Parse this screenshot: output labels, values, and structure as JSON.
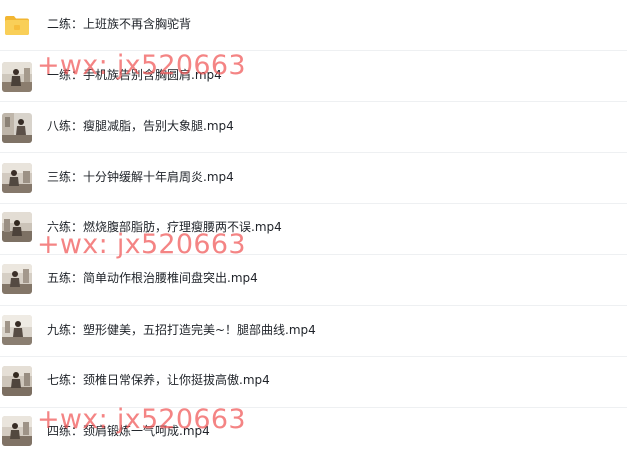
{
  "items": [
    {
      "label": "二练：上班族不再含胸驼背",
      "type": "folder",
      "icon": "folder-icon"
    },
    {
      "label": "一练：手机族告别含胸圆肩.mp4",
      "type": "video",
      "icon": "video-thumbnail"
    },
    {
      "label": "八练：瘦腿减脂，告别大象腿.mp4",
      "type": "video",
      "icon": "video-thumbnail"
    },
    {
      "label": "三练：十分钟缓解十年肩周炎.mp4",
      "type": "video",
      "icon": "video-thumbnail"
    },
    {
      "label": "六练：燃烧腹部脂肪，疗理瘦腰两不误.mp4",
      "type": "video",
      "icon": "video-thumbnail"
    },
    {
      "label": "五练：简单动作根治腰椎间盘突出.mp4",
      "type": "video",
      "icon": "video-thumbnail"
    },
    {
      "label": "九练：塑形健美，五招打造完美~！腿部曲线.mp4",
      "type": "video",
      "icon": "video-thumbnail"
    },
    {
      "label": "七练：颈椎日常保养，让你挺拔高傲.mp4",
      "type": "video",
      "icon": "video-thumbnail"
    },
    {
      "label": "四练：颈肩锻炼一气呵成.mp4",
      "type": "video",
      "icon": "video-thumbnail"
    }
  ],
  "watermarks": [
    "+wx: jx520663",
    "+wx: jx520663",
    "+wx: jx520663"
  ],
  "colors": {
    "text": "#1f2329",
    "divider": "#eef0f2",
    "folder": "#f7c74a",
    "watermark": "#f05454"
  }
}
